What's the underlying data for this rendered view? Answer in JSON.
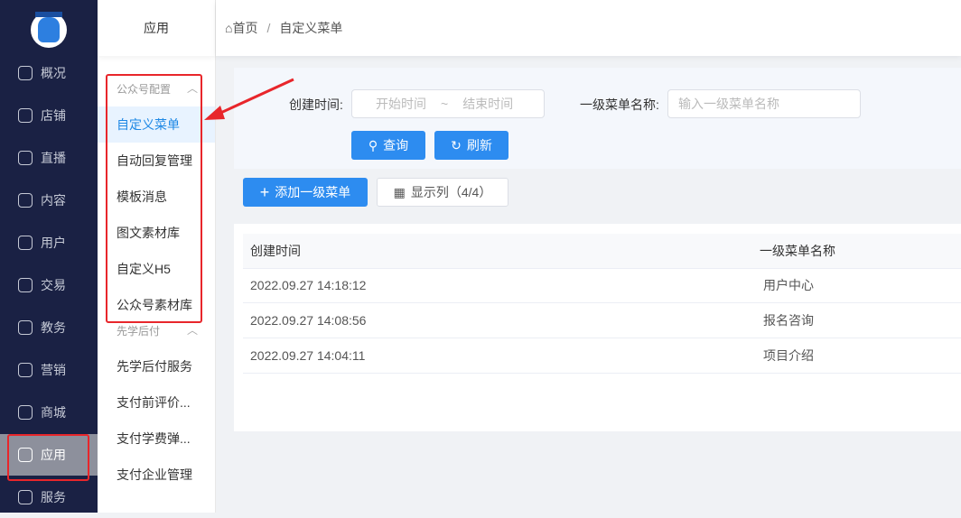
{
  "sidebar": {
    "items": [
      {
        "label": "概况",
        "icon": "pie-chart-icon"
      },
      {
        "label": "店铺",
        "icon": "store-icon"
      },
      {
        "label": "直播",
        "icon": "tv-icon"
      },
      {
        "label": "内容",
        "icon": "book-icon"
      },
      {
        "label": "用户",
        "icon": "user-icon"
      },
      {
        "label": "交易",
        "icon": "yen-icon"
      },
      {
        "label": "教务",
        "icon": "graduation-cap-icon"
      },
      {
        "label": "营销",
        "icon": "trend-chart-icon"
      },
      {
        "label": "商城",
        "icon": "shop-box-icon"
      },
      {
        "label": "应用",
        "icon": "apps-grid-icon",
        "active": true
      },
      {
        "label": "服务",
        "icon": "service-icon"
      }
    ]
  },
  "submenu": {
    "title": "应用",
    "groups": [
      {
        "label": "公众号配置",
        "items": [
          "自定义菜单",
          "自动回复管理",
          "模板消息",
          "图文素材库",
          "自定义H5",
          "公众号素材库"
        ]
      },
      {
        "label": "先学后付",
        "items": [
          "先学后付服务",
          "支付前评价...",
          "支付学费弹...",
          "支付企业管理"
        ]
      }
    ]
  },
  "breadcrumb": {
    "home": "首页",
    "sep": "/",
    "current": "自定义菜单"
  },
  "filter": {
    "created_label": "创建时间:",
    "start_placeholder": "开始时间",
    "range_sep": "~",
    "end_placeholder": "结束时间",
    "menu_name_label": "一级菜单名称:",
    "menu_name_placeholder": "输入一级菜单名称",
    "query": "查询",
    "refresh": "刷新"
  },
  "toolbar": {
    "add": "添加一级菜单",
    "columns": "显示列（4/4）"
  },
  "table": {
    "headers": [
      "创建时间",
      "一级菜单名称"
    ],
    "rows": [
      [
        "2022.09.27 14:18:12",
        "用户中心"
      ],
      [
        "2022.09.27 14:08:56",
        "报名咨询"
      ],
      [
        "2022.09.27 14:04:11",
        "项目介绍"
      ]
    ]
  },
  "colors": {
    "accent": "#2d8cf0",
    "sidebar": "#1a2144",
    "annotation": "#e8262b"
  }
}
